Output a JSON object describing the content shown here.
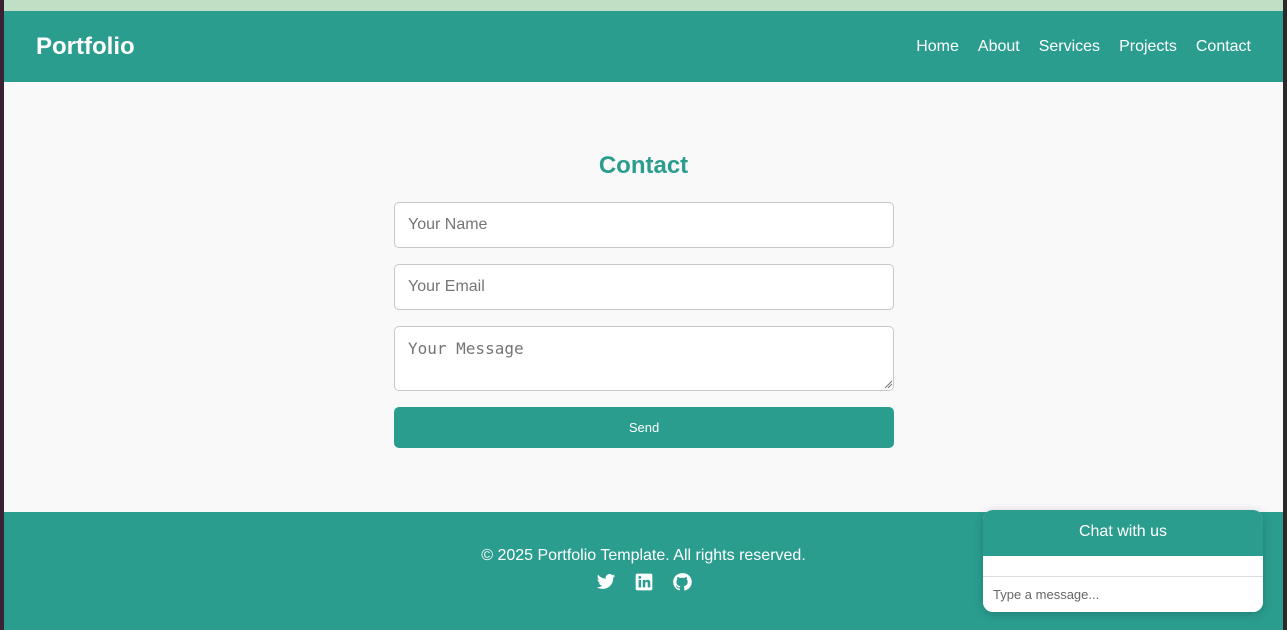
{
  "nav": {
    "brand": "Portfolio",
    "links": [
      "Home",
      "About",
      "Services",
      "Projects",
      "Contact"
    ]
  },
  "contact": {
    "title": "Contact",
    "name_placeholder": "Your Name",
    "email_placeholder": "Your Email",
    "message_placeholder": "Your Message",
    "send_label": "Send"
  },
  "footer": {
    "copyright": "© 2025 Portfolio Template. All rights reserved.",
    "socials": [
      "twitter-icon",
      "linkedin-icon",
      "github-icon"
    ]
  },
  "chat": {
    "title": "Chat with us",
    "input_placeholder": "Type a message..."
  },
  "colors": {
    "primary": "#2a9d8f",
    "background": "#f9f9f9",
    "top_strip": "#bfe0c4"
  }
}
